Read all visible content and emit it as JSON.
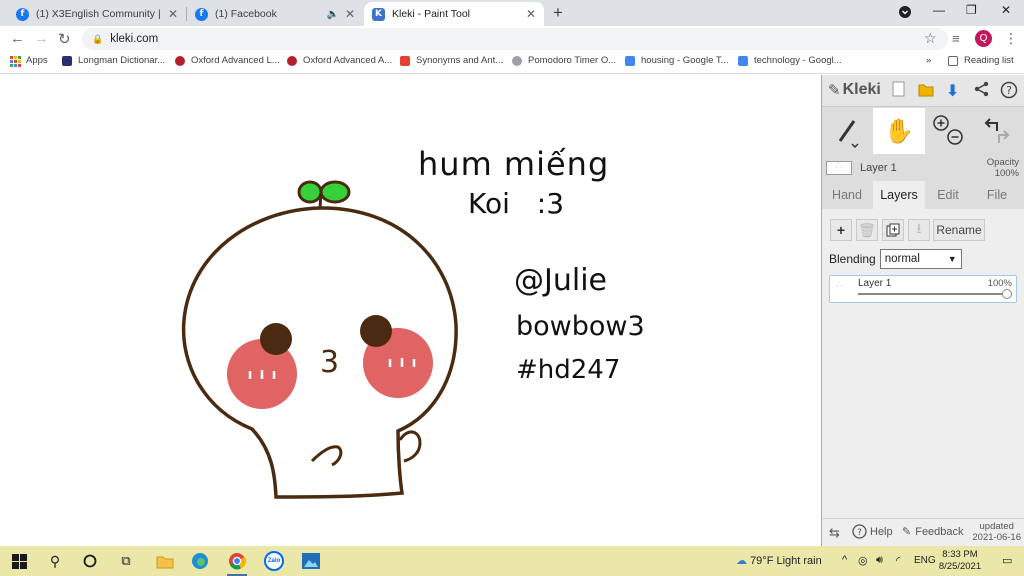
{
  "browser": {
    "tabs": [
      {
        "title": "(1) X3English Community | Facebo"
      },
      {
        "title": "(1) Facebook"
      },
      {
        "title": "Kleki - Paint Tool"
      }
    ],
    "address": "kleki.com",
    "profile_initial": "Q",
    "bookmarks": [
      {
        "label": "Apps",
        "color": "#4285f4"
      },
      {
        "label": "Longman Dictionar...",
        "color": "#2c2c6e"
      },
      {
        "label": "Oxford Advanced L...",
        "color": "#b5202d"
      },
      {
        "label": "Oxford Advanced A...",
        "color": "#b5202d"
      },
      {
        "label": "Synonyms and Ant...",
        "color": "#e2442f"
      },
      {
        "label": "Pomodoro Timer O...",
        "color": "#9aa0a6"
      },
      {
        "label": "housing - Google T...",
        "color": "#4285f4"
      },
      {
        "label": "technology - Googl...",
        "color": "#4285f4"
      }
    ],
    "reading_list": "Reading list",
    "more": "»"
  },
  "canvas": {
    "text_line1": "hum miếng",
    "text_line2": "Koi :3",
    "text_line3": "@Julie",
    "text_line4": "bowbow3",
    "text_line5": "#hd247",
    "mouth": "3"
  },
  "kleki": {
    "logo": "Kleki",
    "layer_name": "Layer 1",
    "opacity_label": "Opacity",
    "opacity_value": "100%",
    "tabs": [
      "Hand",
      "Layers",
      "Edit",
      "File"
    ],
    "rename": "Rename",
    "blending_label": "Blending",
    "blending_value": "normal",
    "layer_item_name": "Layer 1",
    "layer_item_opacity": "100%",
    "layer_item_opacity_fraction": 1.0,
    "help": "Help",
    "feedback": "Feedback",
    "updated_label": "updated",
    "updated_date": "2021-06-16"
  },
  "taskbar": {
    "weather": "79°F  Light rain",
    "lang": "ENG",
    "time": "8:33 PM",
    "date": "8/25/2021",
    "zalo": "Zalo"
  }
}
